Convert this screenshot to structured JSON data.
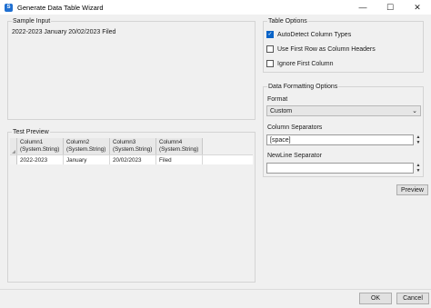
{
  "window": {
    "title": "Generate Data Table Wizard",
    "icon_label": "S",
    "controls": {
      "minimize": "—",
      "maximize": "☐",
      "close": "✕"
    }
  },
  "sample_input": {
    "label": "Sample Input",
    "text": "2022-2023 January 20/02/2023 Filed"
  },
  "test_preview": {
    "label": "Test Preview",
    "columns": [
      {
        "name": "Column1",
        "type": "(System.String)"
      },
      {
        "name": "Column2",
        "type": "(System.String)"
      },
      {
        "name": "Column3",
        "type": "(System.String)"
      },
      {
        "name": "Column4",
        "type": "(System.String)"
      }
    ],
    "rows": [
      [
        "2022-2023",
        "January",
        "20/02/2023",
        "Filed"
      ]
    ]
  },
  "table_options": {
    "label": "Table Options",
    "autodetect": {
      "label": "AutoDetect Column Types",
      "checked": true
    },
    "first_row_headers": {
      "label": "Use First Row as Column Headers",
      "checked": false
    },
    "ignore_first_column": {
      "label": "Ignore First Column",
      "checked": false
    }
  },
  "data_formatting": {
    "label": "Data Formatting Options",
    "format_label": "Format",
    "format_value": "Custom",
    "column_sep_label": "Column Separators",
    "column_sep_value": "[space]",
    "newline_sep_label": "NewLine Separator",
    "newline_sep_value": "",
    "preview_button": "Preview"
  },
  "footer": {
    "ok": "OK",
    "cancel": "Cancel"
  }
}
